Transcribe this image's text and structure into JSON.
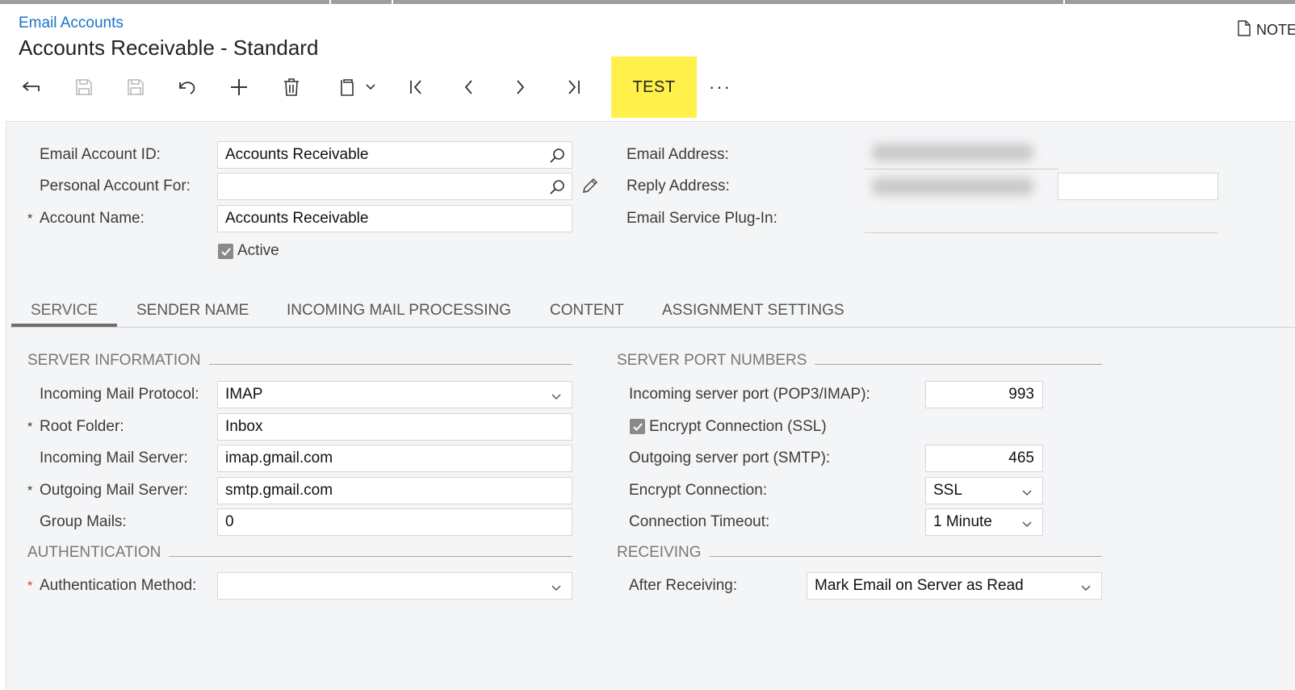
{
  "breadcrumb": "Email Accounts",
  "title": "Accounts Receivable - Standard",
  "notes_label": "NOTE",
  "toolbar": {
    "test_label": "TEST",
    "more_label": "···",
    "icons": [
      "back-icon",
      "save-close-icon",
      "save-icon",
      "undo-icon",
      "add-icon",
      "delete-icon",
      "copy-icon",
      "first-icon",
      "previous-icon",
      "next-icon",
      "last-icon"
    ]
  },
  "form": {
    "email_account_id": {
      "label": "Email Account ID:",
      "value": "Accounts Receivable"
    },
    "personal_account_for": {
      "label": "Personal Account For:",
      "value": ""
    },
    "account_name": {
      "label": "Account Name:",
      "value": "Accounts Receivable"
    },
    "active": {
      "label": "Active",
      "checked": true
    },
    "email_address": {
      "label": "Email Address:"
    },
    "reply_address": {
      "label": "Reply Address:"
    },
    "email_service_plugin": {
      "label": "Email Service Plug-In:"
    }
  },
  "tabs": [
    "SERVICE",
    "SENDER NAME",
    "INCOMING MAIL PROCESSING",
    "CONTENT",
    "ASSIGNMENT SETTINGS"
  ],
  "active_tab": "SERVICE",
  "server_info": {
    "heading": "SERVER INFORMATION",
    "incoming_protocol": {
      "label": "Incoming Mail Protocol:",
      "value": "IMAP"
    },
    "root_folder": {
      "label": "Root Folder:",
      "value": "Inbox"
    },
    "incoming_server": {
      "label": "Incoming Mail Server:",
      "value": "imap.gmail.com"
    },
    "outgoing_server": {
      "label": "Outgoing Mail Server:",
      "value": "smtp.gmail.com"
    },
    "group_mails": {
      "label": "Group Mails:",
      "value": "0"
    }
  },
  "authentication": {
    "heading": "AUTHENTICATION",
    "method": {
      "label": "Authentication Method:",
      "value": ""
    }
  },
  "ports": {
    "heading": "SERVER PORT NUMBERS",
    "incoming_port": {
      "label": "Incoming server port (POP3/IMAP):",
      "value": "993"
    },
    "encrypt_ssl": {
      "label": "Encrypt Connection (SSL)",
      "checked": true
    },
    "outgoing_port": {
      "label": "Outgoing server port (SMTP):",
      "value": "465"
    },
    "encrypt_connection": {
      "label": "Encrypt Connection:",
      "value": "SSL"
    },
    "timeout": {
      "label": "Connection Timeout:",
      "value": "1 Minute"
    }
  },
  "receiving": {
    "heading": "RECEIVING",
    "after_receiving": {
      "label": "After Receiving:",
      "value": "Mark Email on Server as Read"
    }
  },
  "colors": {
    "accent": "#1a73c7",
    "highlight": "#fff04a",
    "required": "#d9342b"
  }
}
